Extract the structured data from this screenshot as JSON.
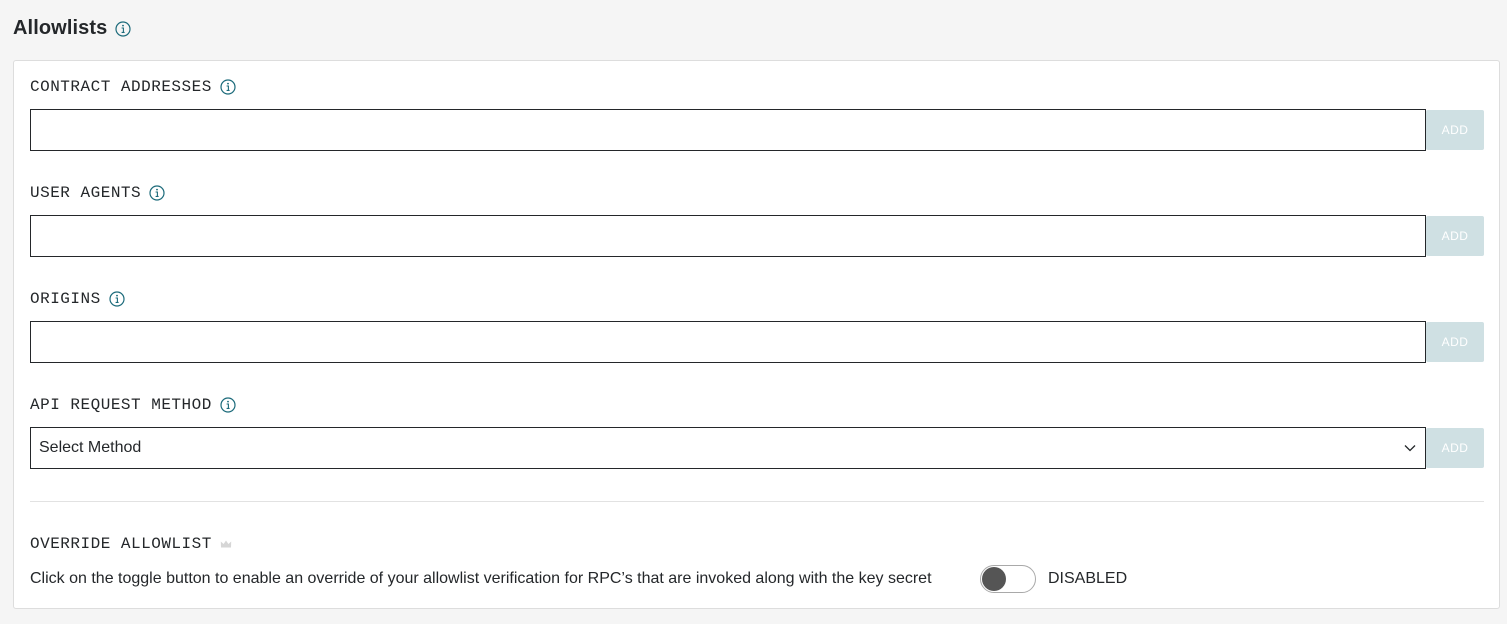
{
  "header": {
    "title": "Allowlists",
    "info_icon": "info-icon"
  },
  "fields": {
    "contract_addresses": {
      "label": "CONTRACT ADDRESSES",
      "value": "",
      "placeholder": "",
      "add_label": "ADD"
    },
    "user_agents": {
      "label": "USER AGENTS",
      "value": "",
      "placeholder": "",
      "add_label": "ADD"
    },
    "origins": {
      "label": "ORIGINS",
      "value": "",
      "placeholder": "",
      "add_label": "ADD"
    },
    "api_request_method": {
      "label": "API REQUEST METHOD",
      "selected": "Select Method",
      "add_label": "ADD"
    }
  },
  "override": {
    "label": "OVERRIDE ALLOWLIST",
    "icon": "crown-icon",
    "description": "Click on the toggle button to enable an override of your allowlist verification for RPC’s that are invoked along with the key secret",
    "toggle_on": false,
    "status": "DISABLED"
  },
  "colors": {
    "background": "#f5f5f5",
    "card": "#ffffff",
    "add_button_disabled": "#cfe0e3",
    "info_icon": "#1b6a7a",
    "toggle_knob": "#555555"
  }
}
